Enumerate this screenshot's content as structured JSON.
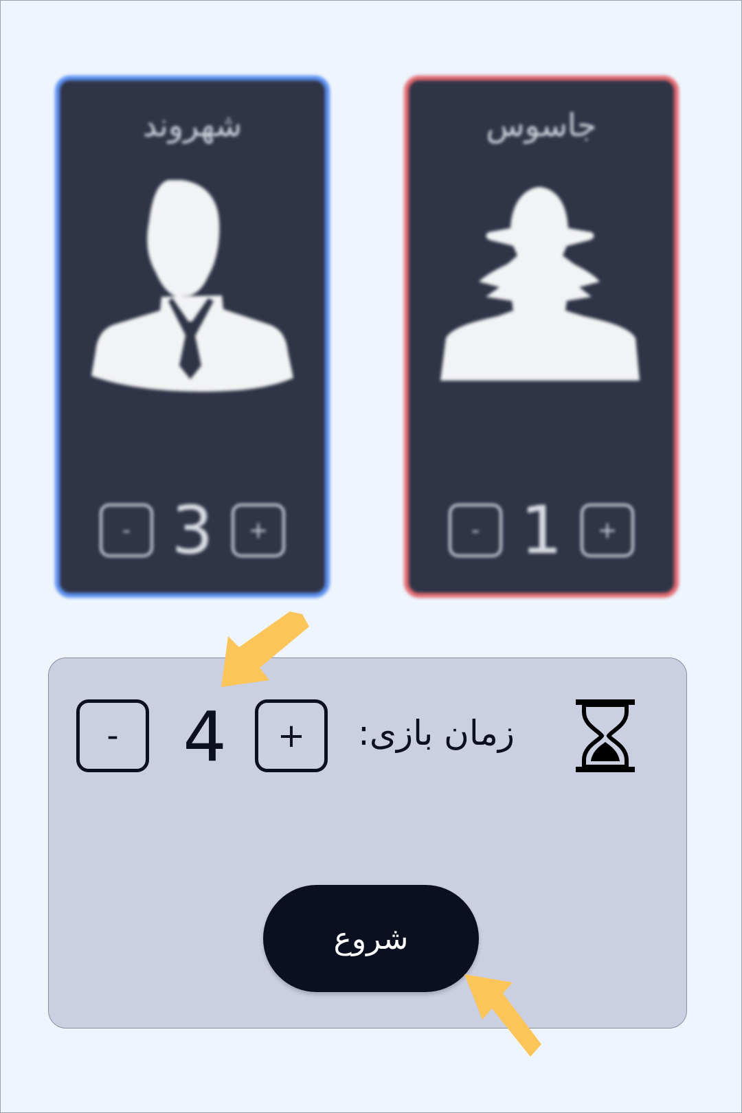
{
  "cards": {
    "citizen": {
      "title": "شهروند",
      "count": "3",
      "minus": "-",
      "plus": "+"
    },
    "spy": {
      "title": "جاسوس",
      "count": "1",
      "minus": "-",
      "plus": "+"
    }
  },
  "timer": {
    "label": "زمان بازی:",
    "value": "4",
    "minus": "-",
    "plus": "+"
  },
  "start_label": "شروع",
  "colors": {
    "background": "#eef5fd",
    "card_bg": "#2f3446",
    "citizen_border": "#5b8ff0",
    "spy_border": "#e46a72",
    "panel_bg": "#cacfe2",
    "dark": "#0b1020",
    "arrow": "#fcc55a"
  },
  "icons": [
    "citizen-silhouette-icon",
    "spy-silhouette-icon",
    "hourglass-icon",
    "pointer-arrow-icon"
  ]
}
